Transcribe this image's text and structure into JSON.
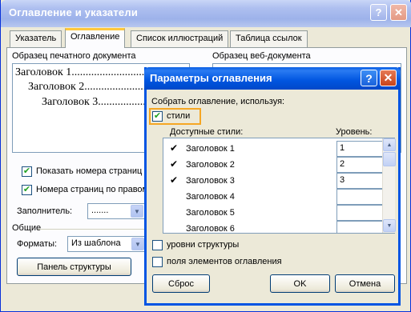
{
  "window": {
    "title": "Оглавление и указатели",
    "help": "?",
    "close": "✕"
  },
  "tabs": [
    "Указатель",
    "Оглавление",
    "Список иллюстраций",
    "Таблица ссылок"
  ],
  "print_preview": {
    "label": "Образец печатного документа",
    "lines": [
      "Заголовок 1..............................",
      "Заголовок 2............................",
      "Заголовок 3.........................."
    ]
  },
  "web_preview": {
    "label": "Образец веб-документа"
  },
  "options": {
    "show_page_numbers": "Показать номера страниц",
    "right_align": "Номера страниц по правому",
    "filler_label": "Заполнитель:",
    "filler_value": ".......",
    "general_label": "Общие",
    "formats_label": "Форматы:",
    "formats_value": "Из шаблона",
    "outline_button": "Панель структуры"
  },
  "dialog": {
    "title": "Параметры оглавления",
    "help": "?",
    "close": "✕",
    "build_label": "Собрать оглавление, используя:",
    "styles_checkbox": "стили",
    "available_styles": "Доступные стили:",
    "level_header": "Уровень:",
    "rows": [
      {
        "name": "Заголовок 1",
        "checked": "✔",
        "level": "1"
      },
      {
        "name": "Заголовок 2",
        "checked": "✔",
        "level": "2"
      },
      {
        "name": "Заголовок 3",
        "checked": "✔",
        "level": "3"
      },
      {
        "name": "Заголовок 4",
        "checked": "",
        "level": ""
      },
      {
        "name": "Заголовок 5",
        "checked": "",
        "level": ""
      },
      {
        "name": "Заголовок 6",
        "checked": "",
        "level": ""
      }
    ],
    "outline_levels": "уровни структуры",
    "toc_fields": "поля элементов оглавления",
    "reset_button": "Сброс",
    "ok_button": "OK",
    "cancel_button": "Отмена"
  },
  "colors": {
    "title_active": "#0055e0",
    "focus": "#f5a623",
    "window_bg": "#ECE9D8"
  }
}
